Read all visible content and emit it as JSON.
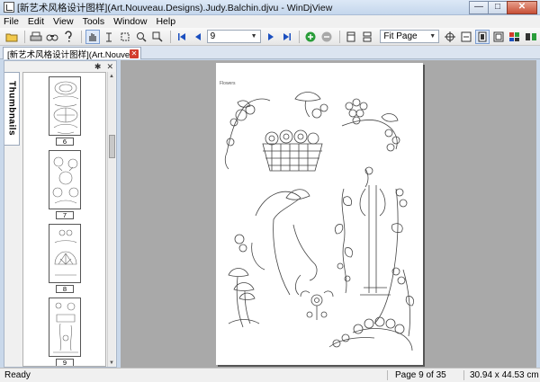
{
  "window": {
    "title": "[新艺术风格设计图样](Art.Nouveau.Designs).Judy.Balchin.djvu - WinDjView",
    "minimize_glyph": "—",
    "maximize_glyph": "□",
    "close_glyph": "✕"
  },
  "menu": [
    "File",
    "Edit",
    "View",
    "Tools",
    "Window",
    "Help"
  ],
  "toolbar": {
    "page_number": "9",
    "zoom": "Fit Page"
  },
  "tab": {
    "label": "[新艺术风格设计图样](Art.Nouvea...",
    "close_glyph": "✕"
  },
  "sidebar": {
    "panel_name": "Thumbnails",
    "pin_glyph": "✱",
    "close_glyph": "✕",
    "thumbnails": [
      {
        "page": "6"
      },
      {
        "page": "7"
      },
      {
        "page": "8"
      },
      {
        "page": "9"
      }
    ]
  },
  "page_view": {
    "heading": "Flowers"
  },
  "status": {
    "text": "Ready",
    "page": "Page 9 of 35",
    "size": "30.94 x 44.53 cm"
  }
}
